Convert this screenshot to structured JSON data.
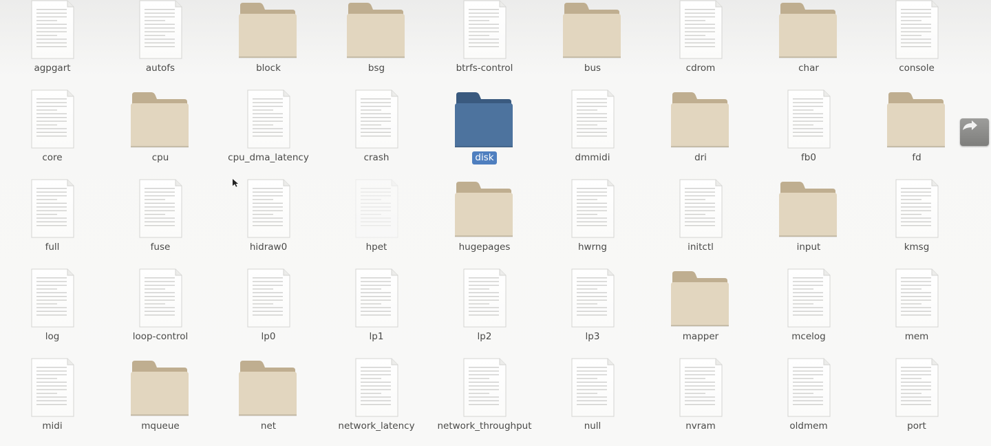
{
  "colors": {
    "folder_body": "#e2d6bf",
    "folder_tab": "#bfae90",
    "selected_folder_body": "#4d739e",
    "selected_folder_tab": "#3a5a7f",
    "selection_label_bg": "#4f7fbf",
    "document_paper": "#fbfbfa"
  },
  "items": [
    {
      "name": "agpgart",
      "type": "file"
    },
    {
      "name": "autofs",
      "type": "file"
    },
    {
      "name": "block",
      "type": "folder"
    },
    {
      "name": "bsg",
      "type": "folder"
    },
    {
      "name": "btrfs-control",
      "type": "file"
    },
    {
      "name": "bus",
      "type": "folder"
    },
    {
      "name": "cdrom",
      "type": "file"
    },
    {
      "name": "char",
      "type": "folder"
    },
    {
      "name": "console",
      "type": "file"
    },
    {
      "name": "core",
      "type": "file"
    },
    {
      "name": "cpu",
      "type": "folder"
    },
    {
      "name": "cpu_dma_latency",
      "type": "file"
    },
    {
      "name": "crash",
      "type": "file"
    },
    {
      "name": "disk",
      "type": "folder",
      "selected": true
    },
    {
      "name": "dmmidi",
      "type": "file"
    },
    {
      "name": "dri",
      "type": "folder"
    },
    {
      "name": "fb0",
      "type": "file"
    },
    {
      "name": "fd",
      "type": "folder",
      "symlink": true
    },
    {
      "name": "full",
      "type": "file"
    },
    {
      "name": "fuse",
      "type": "file"
    },
    {
      "name": "hidraw0",
      "type": "file"
    },
    {
      "name": "hpet",
      "type": "file",
      "faded": true
    },
    {
      "name": "hugepages",
      "type": "folder"
    },
    {
      "name": "hwrng",
      "type": "file"
    },
    {
      "name": "initctl",
      "type": "file"
    },
    {
      "name": "input",
      "type": "folder"
    },
    {
      "name": "kmsg",
      "type": "file"
    },
    {
      "name": "log",
      "type": "file"
    },
    {
      "name": "loop-control",
      "type": "file"
    },
    {
      "name": "lp0",
      "type": "file"
    },
    {
      "name": "lp1",
      "type": "file"
    },
    {
      "name": "lp2",
      "type": "file"
    },
    {
      "name": "lp3",
      "type": "file"
    },
    {
      "name": "mapper",
      "type": "folder"
    },
    {
      "name": "mcelog",
      "type": "file"
    },
    {
      "name": "mem",
      "type": "file"
    },
    {
      "name": "midi",
      "type": "file"
    },
    {
      "name": "mqueue",
      "type": "folder"
    },
    {
      "name": "net",
      "type": "folder"
    },
    {
      "name": "network_latency",
      "type": "file"
    },
    {
      "name": "network_throughput",
      "type": "file"
    },
    {
      "name": "null",
      "type": "file"
    },
    {
      "name": "nvram",
      "type": "file"
    },
    {
      "name": "oldmem",
      "type": "file"
    },
    {
      "name": "port",
      "type": "file"
    }
  ]
}
